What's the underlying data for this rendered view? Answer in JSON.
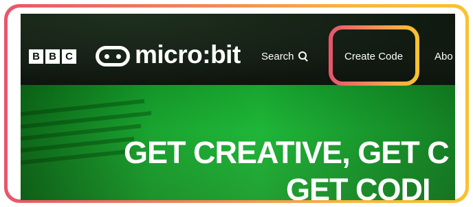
{
  "brand": {
    "bbc_letters": [
      "B",
      "B",
      "C"
    ],
    "product_name": "micro:bit"
  },
  "nav": {
    "search_label": "Search",
    "create_code_label": "Create Code",
    "about_label": "Abo"
  },
  "hero": {
    "headline": "GET CREATIVE, GET C",
    "subheadline": "GET CODI"
  },
  "colors": {
    "frame_gradient_start": "#e8566c",
    "frame_gradient_end": "#f9c22f",
    "hero_green": "#1fb638",
    "navbar_bg": "#121a12"
  },
  "icons": {
    "search": "magnifying-glass",
    "microbit_logo": "rounded-rectangle-two-dots"
  }
}
